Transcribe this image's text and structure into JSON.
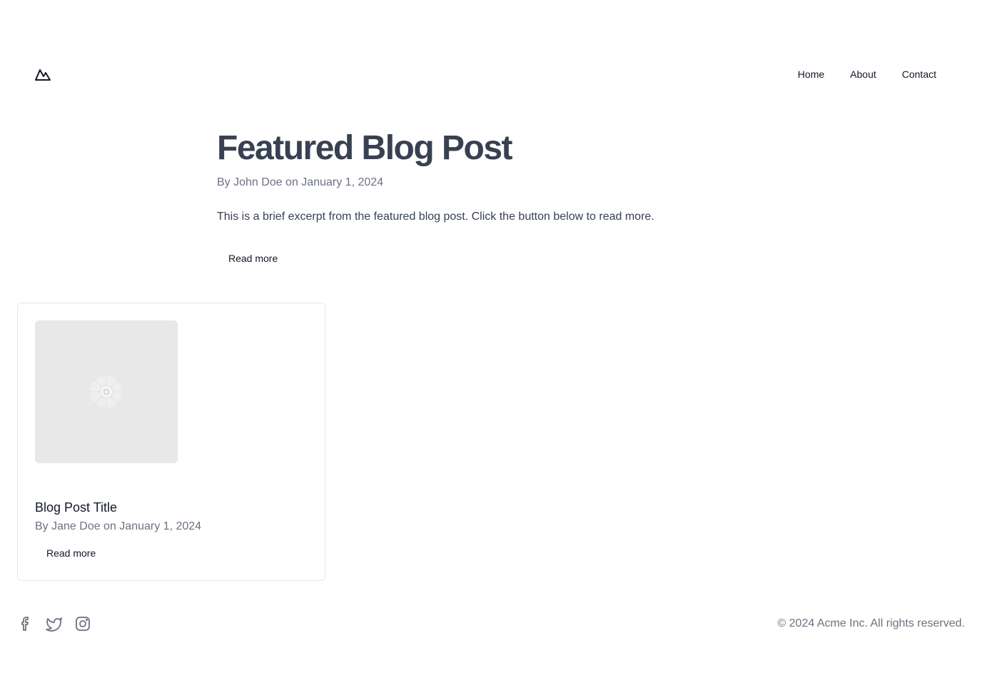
{
  "header": {
    "logo_icon": "mountain-icon",
    "nav": [
      {
        "label": "Home"
      },
      {
        "label": "About"
      },
      {
        "label": "Contact"
      }
    ]
  },
  "featured": {
    "title": "Featured Blog Post",
    "meta": "By John Doe on January 1, 2024",
    "excerpt": "This is a brief excerpt from the featured blog post. Click the button below to read more.",
    "button_label": "Read more"
  },
  "posts": [
    {
      "image_icon": "image-placeholder-icon",
      "title": "Blog Post Title",
      "meta": "By Jane Doe on January 1, 2024",
      "button_label": "Read more"
    }
  ],
  "footer": {
    "social_icons": [
      "facebook-icon",
      "twitter-icon",
      "instagram-icon"
    ],
    "copyright": "© 2024 Acme Inc. All rights reserved."
  },
  "colors": {
    "heading": "#374151",
    "muted": "#6b7280",
    "text": "#111827",
    "border": "#e5e7eb",
    "placeholder": "#e8e8e8"
  }
}
